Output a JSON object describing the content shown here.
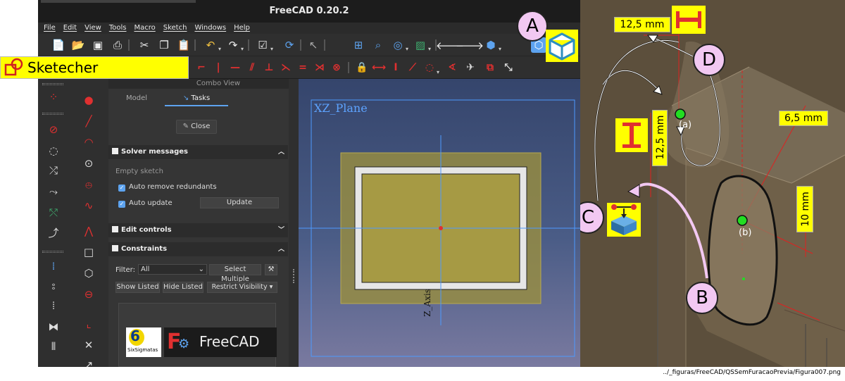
{
  "window": {
    "title": "FreeCAD 0.20.2"
  },
  "menu": [
    "File",
    "Edit",
    "View",
    "Tools",
    "Macro",
    "Sketch",
    "Windows",
    "Help"
  ],
  "workbench_label": "Sketecher",
  "combo_view": {
    "title": "Combo View",
    "tabs": [
      "Model",
      "Tasks"
    ],
    "close_label": "Close",
    "solver": {
      "title": "Solver messages",
      "message": "Empty sketch",
      "auto_remove": "Auto remove redundants",
      "auto_update": "Auto update",
      "update_btn": "Update"
    },
    "edit_controls": {
      "title": "Edit controls"
    },
    "constraints": {
      "title": "Constraints",
      "filter_label": "Filter:",
      "filter_value": "All",
      "select_multiple": "Select Multiple",
      "show_listed": "Show Listed",
      "hide_listed": "Hide Listed",
      "restrict_visibility": "Restrict Visibility"
    },
    "logos": {
      "sixsigmatas": "SixSigmatas",
      "freecad": "FreeCAD"
    }
  },
  "view3d": {
    "plane_label": "XZ_Plane",
    "axis_label": "Z_Axis"
  },
  "callouts": {
    "a": "A",
    "b": "B",
    "c": "C",
    "d": "D"
  },
  "dimensions": {
    "top_h": "12,5 mm",
    "left_v": "12,5 mm",
    "right_h": "6,5 mm",
    "right_v": "10 mm"
  },
  "points": {
    "a": "(a)",
    "b": "(b)"
  },
  "caption": "../_figuras/FreeCAD/QSSemFuracaoPrevia/Figura007.png",
  "colors": {
    "sketcher_red": "#e03030",
    "highlight_yellow": "#ffff00",
    "callout_pink": "#f2c8f2",
    "point_green": "#22dd22"
  }
}
